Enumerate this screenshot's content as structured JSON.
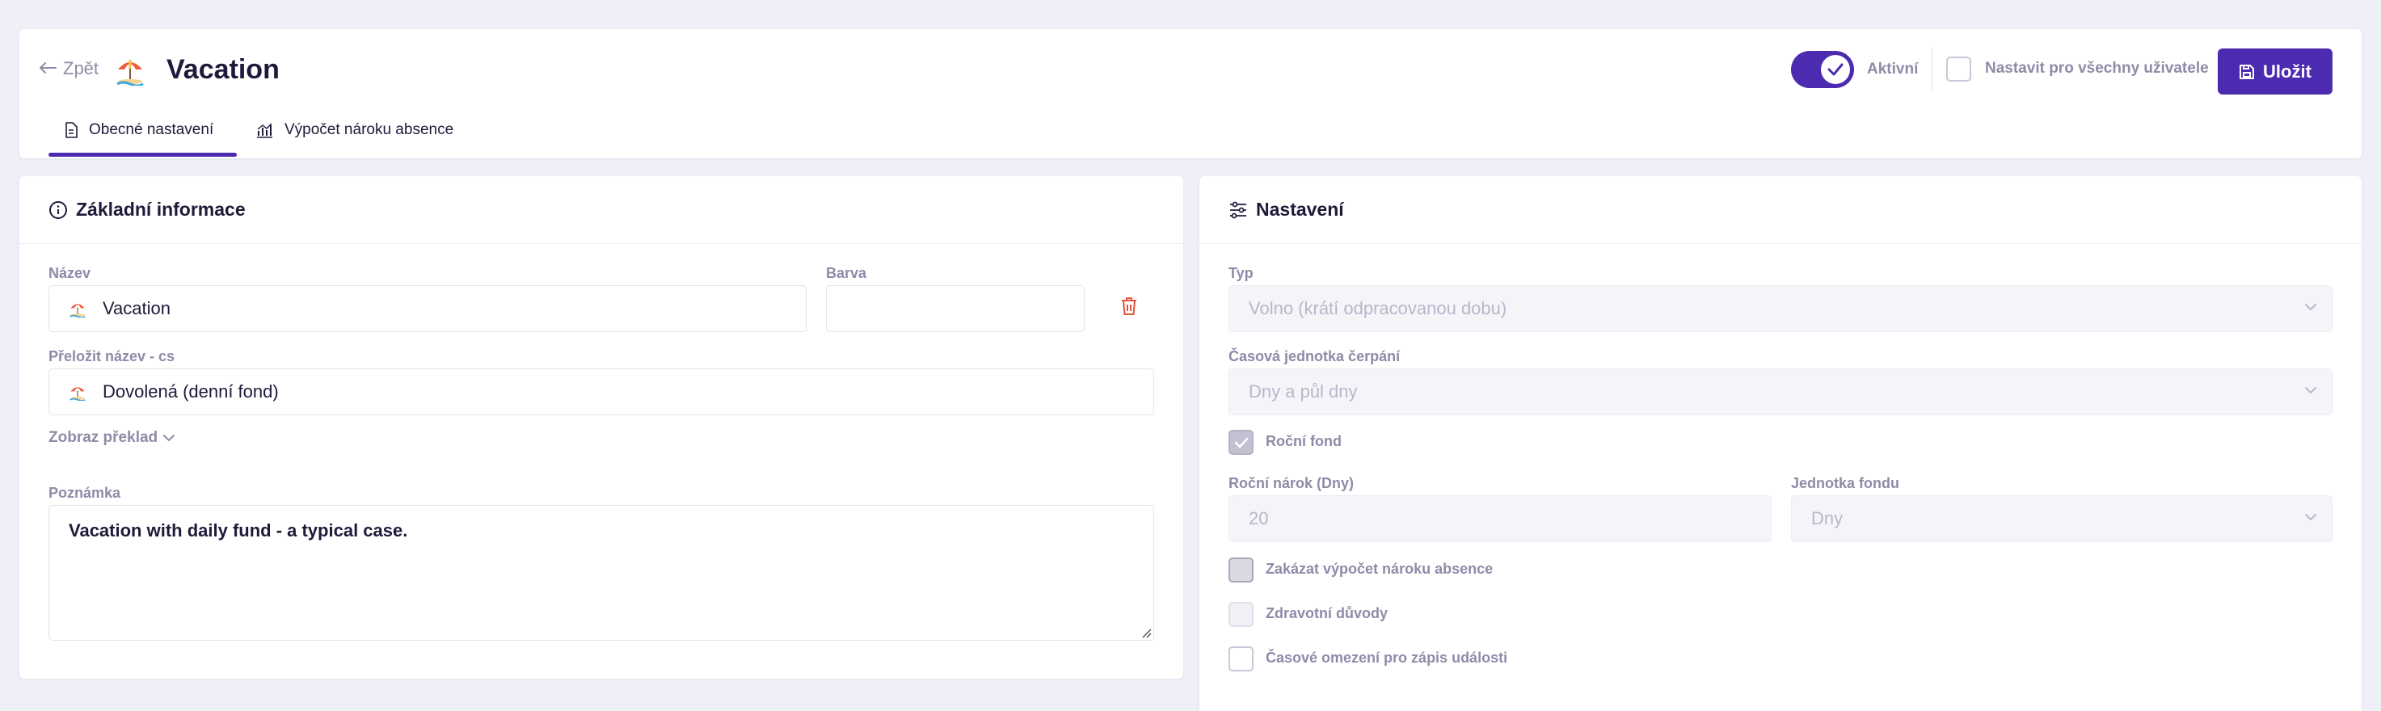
{
  "header": {
    "back_label": "Zpět",
    "title": "Vacation",
    "tabs": [
      {
        "label": "Obecné nastavení",
        "icon": "document-icon",
        "active": true
      },
      {
        "label": "Výpočet nároku absence",
        "icon": "bar-chart-icon",
        "active": false
      }
    ],
    "active_toggle_label": "Aktivní",
    "active_toggle_on": true,
    "all_users_label": "Nastavit pro všechny uživatele",
    "all_users_checked": false,
    "save_label": "Uložit"
  },
  "basic_info": {
    "title": "Základní informace",
    "name_label": "Název",
    "name_value": "Vacation",
    "color_label": "Barva",
    "color_value": "",
    "translate_label": "Přeložit název - cs",
    "translate_value": "Dovolená (denní fond)",
    "show_translation_label": "Zobraz překlad",
    "note_label": "Poznámka",
    "note_value": "Vacation with daily fund - a typical case."
  },
  "settings": {
    "title": "Nastavení",
    "type_label": "Typ",
    "type_value": "Volno (krátí odpracovanou dobu)",
    "time_unit_label": "Časová jednotka čerpání",
    "time_unit_value": "Dny a půl dny",
    "annual_fund_label": "Roční fond",
    "annual_fund_checked": true,
    "annual_entitlement_label": "Roční nárok (Dny)",
    "annual_entitlement_value": "20",
    "fund_unit_label": "Jednotka fondu",
    "fund_unit_value": "Dny",
    "disable_calc_label": "Zakázat výpočet nároku absence",
    "health_reasons_label": "Zdravotní důvody",
    "time_limit_label": "Časové omezení pro zápis události"
  },
  "colors": {
    "accent": "#4c2bb0",
    "background": "#eeeff7",
    "muted_text": "#8e8ba8",
    "danger": "#e0523b"
  }
}
